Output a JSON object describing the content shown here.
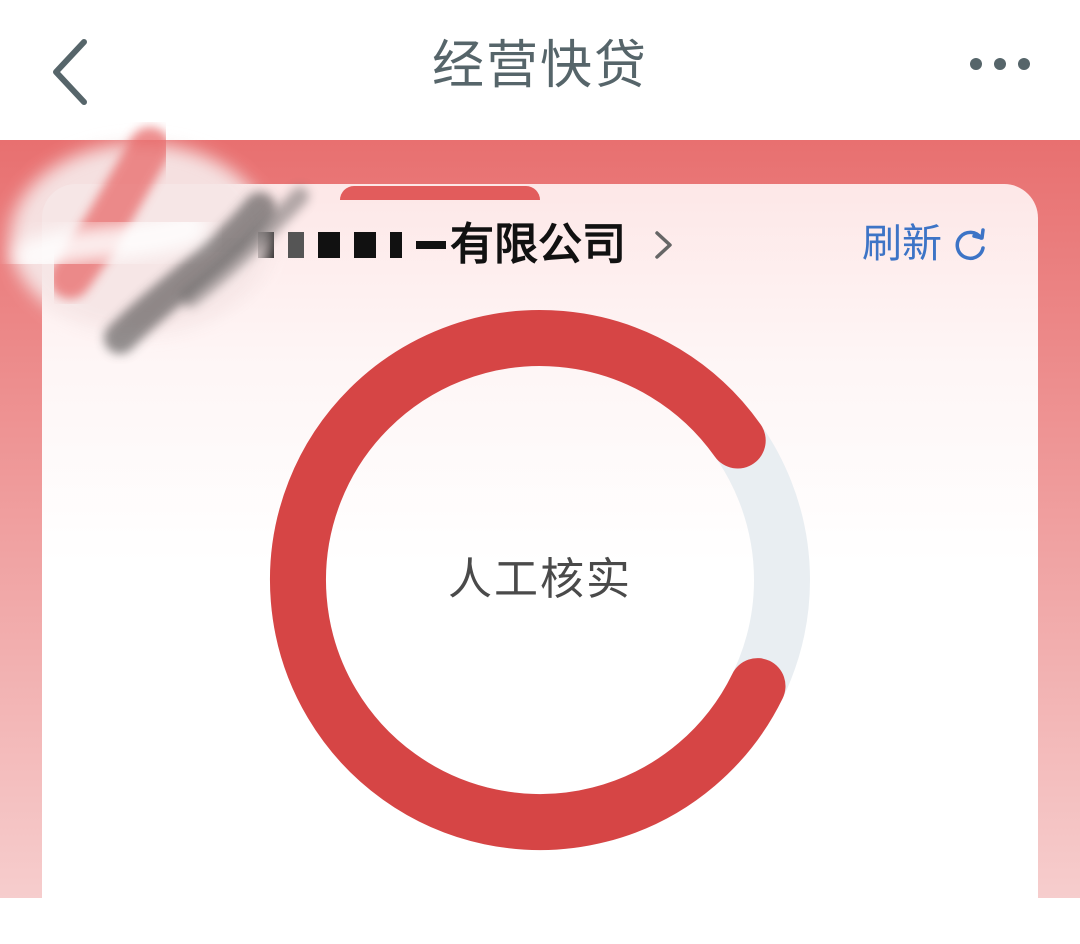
{
  "nav": {
    "title": "经营快贷",
    "back_icon": "chevron-left-icon",
    "more_icon": "more-horizontal-icon"
  },
  "card": {
    "company_name": "有限公司",
    "company_chevron_icon": "chevron-right-icon",
    "refresh_label": "刷新",
    "refresh_icon": "refresh-icon"
  },
  "status": {
    "label": "人工核实",
    "progress_fraction": 0.83
  },
  "colors": {
    "nav_text": "#56656a",
    "accent_red": "#d64545",
    "track": "#e9eef2",
    "refresh_blue": "#3d74c6",
    "banner_top": "#e87070"
  }
}
